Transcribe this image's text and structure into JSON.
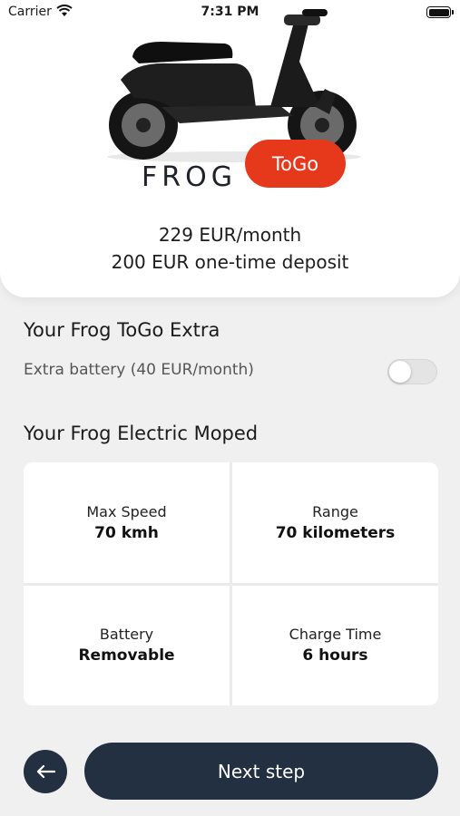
{
  "status_bar": {
    "carrier": "Carrier",
    "time": "7:31 PM",
    "battery_level": 1.0
  },
  "hero": {
    "brand": "FROG",
    "badge": "ToGo",
    "price_monthly": "229 EUR/month",
    "price_deposit": "200 EUR one-time deposit",
    "badge_color": "#e6391c"
  },
  "extra": {
    "title": "Your Frog ToGo Extra",
    "battery_label": "Extra battery (40 EUR/month)",
    "battery_toggle_on": false
  },
  "moped": {
    "title": "Your Frog Electric Moped",
    "specs": [
      {
        "label": "Max Speed",
        "value": "70 kmh"
      },
      {
        "label": "Range",
        "value": "70 kilometers"
      },
      {
        "label": "Battery",
        "value": "Removable"
      },
      {
        "label": "Charge Time",
        "value": "6 hours"
      }
    ]
  },
  "footer": {
    "next_label": "Next step",
    "back_icon": "arrow-left-icon",
    "button_color": "#233042"
  }
}
